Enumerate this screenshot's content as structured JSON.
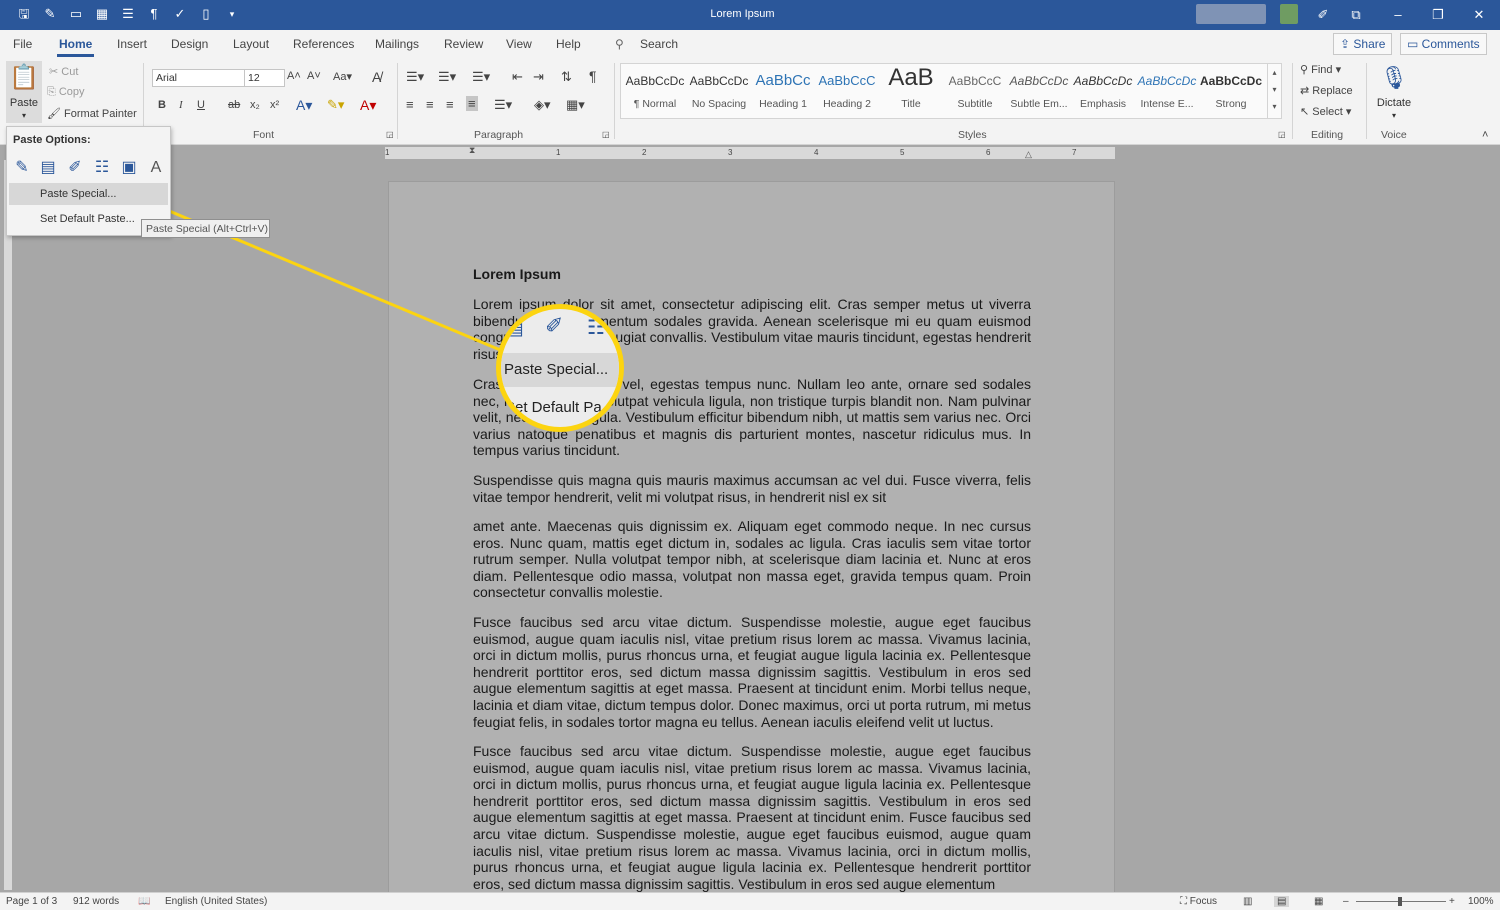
{
  "window": {
    "title": "Lorem Ipsum",
    "quick_access": [
      "save-icon",
      "autosave-icon",
      "open-icon",
      "table-icon",
      "layout-icon",
      "pilcrow-icon",
      "spelling-icon",
      "new-icon",
      "customize-icon"
    ],
    "controls": [
      "pen-icon",
      "ribbon-display-icon",
      "minimize-icon",
      "restore-icon",
      "close-icon"
    ]
  },
  "tabs": [
    "File",
    "Home",
    "Insert",
    "Design",
    "Layout",
    "References",
    "Mailings",
    "Review",
    "View",
    "Help"
  ],
  "active_tab": "Home",
  "search": {
    "label": "Search"
  },
  "header_buttons": {
    "share": "Share",
    "comments": "Comments"
  },
  "clipboard": {
    "paste": "Paste",
    "cut": "Cut",
    "copy": "Copy",
    "format_painter": "Format Painter"
  },
  "font": {
    "group_label": "Font",
    "family": "Arial",
    "size": "12",
    "buttons": {
      "bold": "B",
      "italic": "I",
      "underline": "U",
      "strike": "ab",
      "sub": "x₂",
      "sup": "x²"
    }
  },
  "paragraph": {
    "group_label": "Paragraph"
  },
  "styles": {
    "group_label": "Styles",
    "items": [
      {
        "sample": "AaBbCcDc",
        "name": "¶ Normal"
      },
      {
        "sample": "AaBbCcDc",
        "name": "No Spacing"
      },
      {
        "sample": "AaBbCc",
        "name": "Heading 1"
      },
      {
        "sample": "AaBbCcC",
        "name": "Heading 2"
      },
      {
        "sample": "AaB",
        "name": "Title"
      },
      {
        "sample": "AaBbCcC",
        "name": "Subtitle"
      },
      {
        "sample": "AaBbCcDc",
        "name": "Subtle Em..."
      },
      {
        "sample": "AaBbCcDc",
        "name": "Emphasis"
      },
      {
        "sample": "AaBbCcDc",
        "name": "Intense E..."
      },
      {
        "sample": "AaBbCcDc",
        "name": "Strong"
      }
    ]
  },
  "editing": {
    "group_label": "Editing",
    "find": "Find",
    "replace": "Replace",
    "select": "Select"
  },
  "voice": {
    "group_label": "Voice",
    "dictate": "Dictate"
  },
  "ruler": {
    "numbers": [
      "1",
      "1",
      "2",
      "3",
      "4",
      "5",
      "6",
      "7"
    ]
  },
  "paste_menu": {
    "options_label": "Paste Options:",
    "icons": [
      "keep-source-formatting-icon",
      "merge-formatting-icon",
      "use-destination-styles-icon",
      "merge-list-icon",
      "picture-icon",
      "keep-text-only-icon"
    ],
    "items": [
      "Paste Special...",
      "Set Default Paste..."
    ],
    "tooltip": "Paste Special (Alt+Ctrl+V)"
  },
  "callout": {
    "label1": "Paste Special...",
    "label2": "Set Default Pa",
    "accent": "#fcd410"
  },
  "document": {
    "heading": "Lorem Ipsum",
    "paragraphs": [
      "Lorem ipsum dolor sit amet, consectetur adipiscing elit. Cras semper metus ut viverra bibendum. Duis elementum sodales gravida. Aenean scelerisque mi eu quam euismod congue. Proin luctus feugiat convallis. Vestibulum vitae mauris tincidunt, egestas hendrerit risus.",
      "Cras tristique sed felis vel, egestas tempus nunc. Nullam leo ante, ornare sed sodales nec, non leo. Etiam volutpat vehicula ligula, non tristique turpis blandit non. Nam pulvinar velit, nec pulvinar ligula. Vestibulum efficitur bibendum nibh, ut mattis sem varius nec. Orci varius natoque penatibus et magnis dis parturient montes, nascetur ridiculus mus. In tempus varius tincidunt.",
      "Suspendisse quis magna quis mauris maximus accumsan ac vel dui. Fusce viverra, felis vitae tempor hendrerit, velit mi volutpat risus, in hendrerit nisl ex sit",
      "amet ante. Maecenas quis dignissim ex. Aliquam eget commodo neque. In nec cursus eros. Nunc quam, mattis eget dictum in, sodales ac ligula. Cras iaculis sem vitae tortor rutrum semper. Nulla volutpat tempor nibh, at scelerisque diam lacinia et. Nunc at eros diam. Pellentesque odio massa, volutpat non massa eget, gravida tempus quam. Proin consectetur convallis molestie.",
      "Fusce faucibus sed arcu vitae dictum. Suspendisse molestie, augue eget faucibus euismod, augue quam iaculis nisl, vitae pretium risus lorem ac massa. Vivamus lacinia, orci in dictum mollis, purus rhoncus urna, et feugiat augue ligula lacinia ex. Pellentesque hendrerit porttitor eros, sed dictum massa dignissim sagittis. Vestibulum in eros sed augue elementum sagittis at eget massa. Praesent at tincidunt enim. Morbi tellus neque, lacinia et diam vitae, dictum tempus dolor. Donec maximus, orci ut porta rutrum, mi metus feugiat felis, in sodales tortor magna eu tellus. Aenean iaculis eleifend velit ut luctus.",
      "Fusce faucibus sed arcu vitae dictum. Suspendisse molestie, augue eget faucibus euismod, augue quam iaculis nisl, vitae pretium risus lorem ac massa. Vivamus lacinia, orci in dictum mollis, purus rhoncus urna, et feugiat augue ligula lacinia ex. Pellentesque hendrerit porttitor eros, sed dictum massa dignissim sagittis. Vestibulum in eros sed augue elementum sagittis at eget massa. Praesent at tincidunt enim. Fusce faucibus sed arcu vitae dictum. Suspendisse molestie, augue eget faucibus euismod, augue quam iaculis nisl, vitae pretium risus lorem ac massa. Vivamus lacinia, orci in dictum mollis, purus rhoncus urna, et feugiat augue ligula lacinia ex. Pellentesque hendrerit porttitor eros, sed dictum massa dignissim sagittis. Vestibulum in eros sed augue elementum"
    ]
  },
  "status": {
    "page": "Page 1 of 3",
    "words": "912 words",
    "language": "English (United States)",
    "focus": "Focus",
    "zoom": "100%"
  }
}
